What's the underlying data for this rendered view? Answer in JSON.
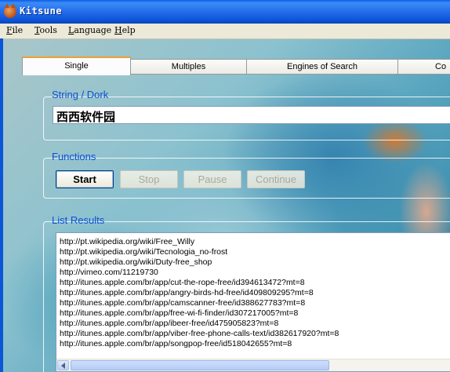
{
  "window": {
    "title": "Kitsune",
    "icon": "fox-icon"
  },
  "menu": [
    {
      "label": "File",
      "underline": "F",
      "rest": "ile"
    },
    {
      "label": "Tools",
      "underline": "T",
      "rest": "ools"
    },
    {
      "label": "Language",
      "underline": "L",
      "rest": "anguage"
    },
    {
      "label": "Help",
      "underline": "H",
      "rest": "elp"
    }
  ],
  "tabs": [
    "Single",
    "Multiples",
    "Engines of Search",
    "Co"
  ],
  "active_tab": "Single",
  "string_group": {
    "label": "String / Dork",
    "value": "西西软件园"
  },
  "functions_group": {
    "label": "Functions",
    "buttons": [
      {
        "label": "Start",
        "enabled": true
      },
      {
        "label": "Stop",
        "enabled": false
      },
      {
        "label": "Pause",
        "enabled": false
      },
      {
        "label": "Continue",
        "enabled": false
      }
    ]
  },
  "results_group": {
    "label": "List Results",
    "items": [
      "http://pt.wikipedia.org/wiki/Free_Willy",
      "http://pt.wikipedia.org/wiki/Tecnologia_no-frost",
      "http://pt.wikipedia.org/wiki/Duty-free_shop",
      "http://vimeo.com/11219730",
      "http://itunes.apple.com/br/app/cut-the-rope-free/id394613472?mt=8",
      "http://itunes.apple.com/br/app/angry-birds-hd-free/id409809295?mt=8",
      "http://itunes.apple.com/br/app/camscanner-free/id388627783?mt=8",
      "http://itunes.apple.com/br/app/free-wi-fi-finder/id307217005?mt=8",
      "http://itunes.apple.com/br/app/ibeer-free/id475905823?mt=8",
      "http://itunes.apple.com/br/app/viber-free-phone-calls-text/id382617920?mt=8",
      "http://itunes.apple.com/br/app/songpop-free/id518042655?mt=8"
    ]
  },
  "colors": {
    "title_bar": "#0a5de6",
    "group_label": "#0b4fd6",
    "tab_highlight": "#f0a030"
  }
}
